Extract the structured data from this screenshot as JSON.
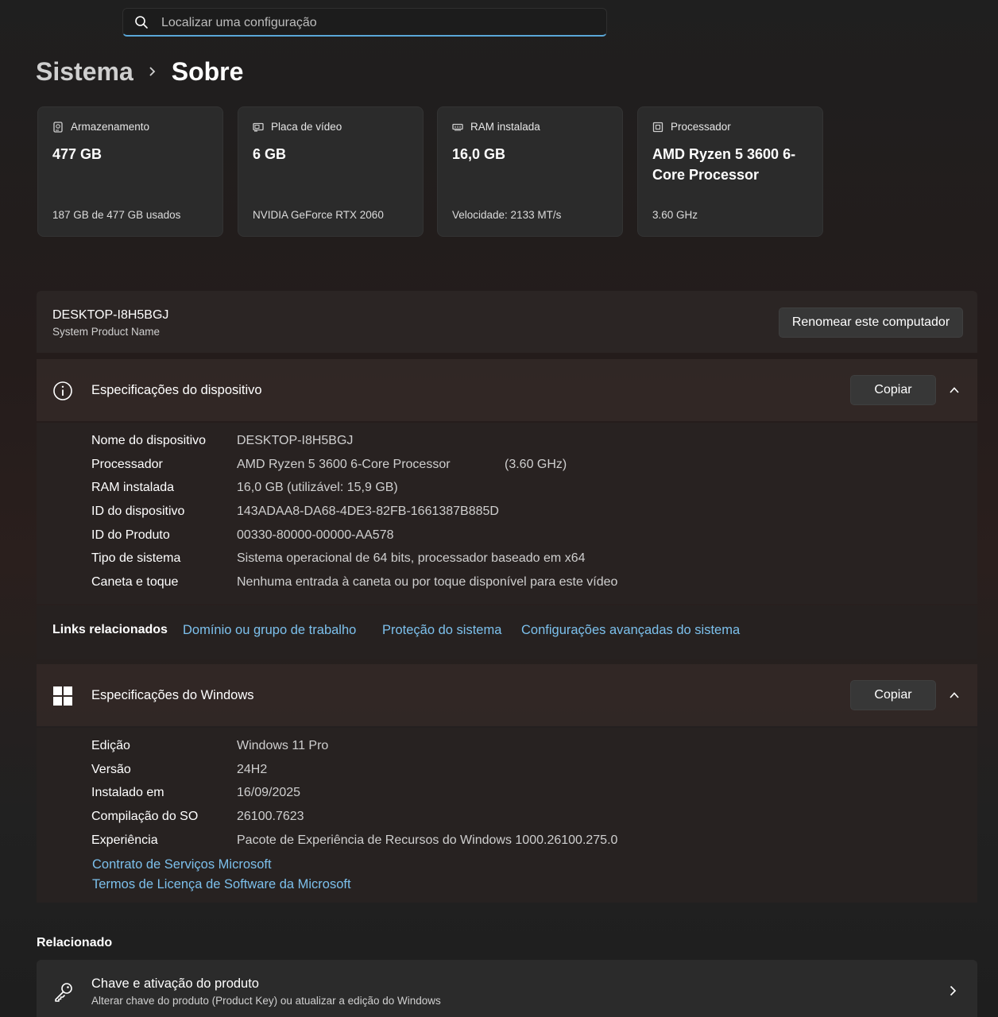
{
  "search": {
    "placeholder": "Localizar uma configuração"
  },
  "breadcrumb": {
    "parent": "Sistema",
    "current": "Sobre"
  },
  "cards": [
    {
      "label": "Armazenamento",
      "value": "477 GB",
      "sub": "187 GB de 477 GB usados",
      "icon": "storage-icon"
    },
    {
      "label": "Placa de vídeo",
      "value": "6 GB",
      "sub": "NVIDIA GeForce RTX 2060",
      "icon": "display-adapter-icon"
    },
    {
      "label": "RAM instalada",
      "value": "16,0 GB",
      "sub": "Velocidade: 2133 MT/s",
      "icon": "memory-icon"
    },
    {
      "label": "Processador",
      "value": "AMD Ryzen 5 3600 6-Core Processor",
      "sub": "3.60 GHz",
      "icon": "processor-icon"
    }
  ],
  "computer": {
    "name": "DESKTOP-I8H5BGJ",
    "model": "System Product Name",
    "rename_label": "Renomear este computador"
  },
  "device_specs": {
    "title": "Especificações do dispositivo",
    "copy_label": "Copiar",
    "rows": [
      {
        "key": "Nome do dispositivo",
        "value": "DESKTOP-I8H5BGJ"
      },
      {
        "key": "Processador",
        "value": "AMD Ryzen 5 3600 6-Core Processor",
        "extra": "(3.60 GHz)"
      },
      {
        "key": "RAM instalada",
        "value": "16,0 GB (utilizável: 15,9 GB)"
      },
      {
        "key": "ID do dispositivo",
        "value": "143ADAA8-DA68-4DE3-82FB-1661387B885D"
      },
      {
        "key": "ID do Produto",
        "value": "00330-80000-00000-AA578"
      },
      {
        "key": "Tipo de sistema",
        "value": "Sistema operacional de 64 bits, processador baseado em x64"
      },
      {
        "key": "Caneta e toque",
        "value": "Nenhuma entrada à caneta ou por toque disponível para este vídeo"
      }
    ]
  },
  "related_links": {
    "label": "Links relacionados",
    "items": [
      "Domínio ou grupo de trabalho",
      "Proteção do sistema",
      "Configurações avançadas do sistema"
    ]
  },
  "windows_specs": {
    "title": "Especificações do Windows",
    "copy_label": "Copiar",
    "rows": [
      {
        "key": "Edição",
        "value": "Windows 11 Pro"
      },
      {
        "key": "Versão",
        "value": "24H2"
      },
      {
        "key": "Instalado em",
        "value": "16/09/2025"
      },
      {
        "key": "Compilação do SO",
        "value": "26100.7623"
      },
      {
        "key": "Experiência",
        "value": "Pacote de Experiência de Recursos do Windows 1000.26100.275.0"
      }
    ],
    "links": [
      "Contrato de Serviços Microsoft",
      "Termos de Licença de Software da Microsoft"
    ]
  },
  "related": {
    "title": "Relacionado",
    "product_key": {
      "title": "Chave e ativação do produto",
      "subtitle": "Alterar chave do produto (Product Key) ou atualizar a edição do Windows"
    }
  },
  "colors": {
    "accent_link": "#7cc0ec",
    "search_underline": "#5aa7d8",
    "card_bg": "#2b2b2b"
  }
}
